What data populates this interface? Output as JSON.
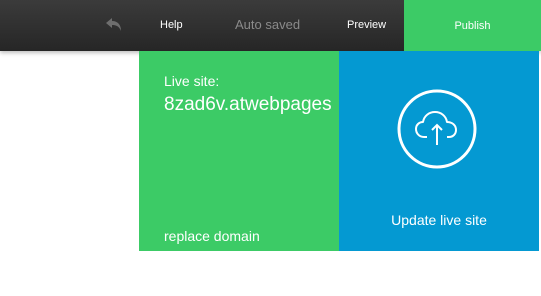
{
  "toolbar": {
    "help_label": "Help",
    "status_text": "Auto saved",
    "preview_label": "Preview",
    "publish_label": "Publish",
    "undo_icon": "undo-arrow-icon"
  },
  "publish_panel": {
    "live_site_label": "Live site:",
    "domain": "8zad6v.atwebpages",
    "replace_domain_label": "replace domain",
    "update_label": "Update live site",
    "upload_icon": "cloud-upload-icon"
  },
  "colors": {
    "toolbar_bg": "#2e2e2e",
    "accent_green": "#3ccb66",
    "accent_blue": "#0499d2"
  }
}
